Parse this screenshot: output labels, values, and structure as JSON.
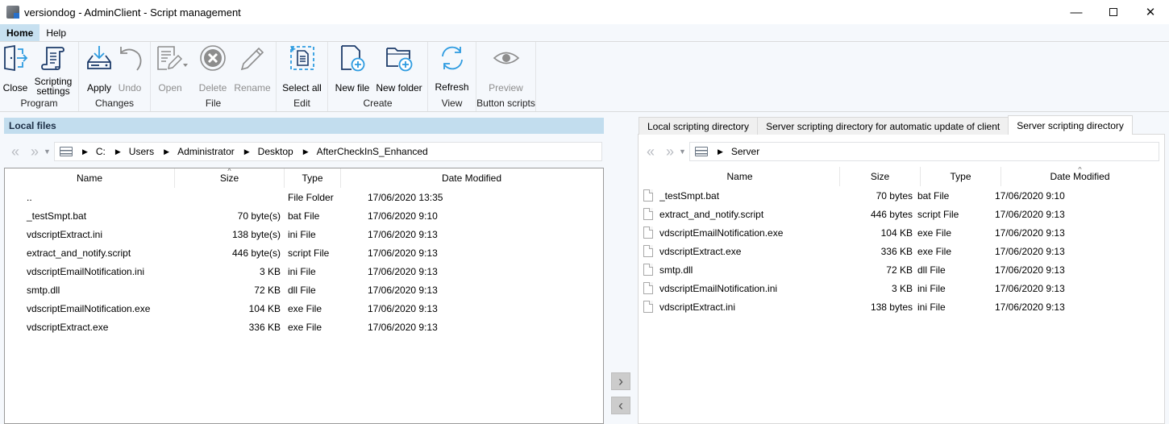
{
  "window": {
    "title": "versiondog - AdminClient - Script management",
    "controls": [
      "minimize",
      "maximize",
      "close"
    ]
  },
  "menu": {
    "tabs": [
      {
        "label": "Home",
        "active": true
      },
      {
        "label": "Help",
        "active": false
      }
    ]
  },
  "ribbon": {
    "groups": [
      {
        "label": "Program",
        "buttons": [
          {
            "label": "Close",
            "icon": "exit-door-icon",
            "enabled": true
          },
          {
            "label": "Scripting settings",
            "icon": "scroll-icon",
            "enabled": true
          }
        ]
      },
      {
        "label": "Changes",
        "buttons": [
          {
            "label": "Apply",
            "icon": "download-drive-icon",
            "enabled": true
          },
          {
            "label": "Undo",
            "icon": "undo-icon",
            "enabled": false
          }
        ]
      },
      {
        "label": "File",
        "buttons": [
          {
            "label": "Open",
            "icon": "open-document-icon",
            "enabled": false
          },
          {
            "label": "Delete",
            "icon": "delete-icon",
            "enabled": false
          },
          {
            "label": "Rename",
            "icon": "pencil-icon",
            "enabled": false
          }
        ]
      },
      {
        "label": "Edit",
        "buttons": [
          {
            "label": "Select all",
            "icon": "select-all-icon",
            "enabled": true
          }
        ]
      },
      {
        "label": "Create",
        "buttons": [
          {
            "label": "New file",
            "icon": "new-file-icon",
            "enabled": true
          },
          {
            "label": "New folder",
            "icon": "new-folder-icon",
            "enabled": true
          }
        ]
      },
      {
        "label": "View",
        "buttons": [
          {
            "label": "Refresh",
            "icon": "refresh-icon",
            "enabled": true
          }
        ]
      },
      {
        "label": "Button scripts",
        "buttons": [
          {
            "label": "Preview",
            "icon": "eye-icon",
            "enabled": false
          }
        ]
      }
    ]
  },
  "local": {
    "header": "Local files",
    "breadcrumb": [
      "C:",
      "Users",
      "Administrator",
      "Desktop",
      "AfterCheckInS_Enhanced"
    ],
    "columns": [
      "Name",
      "Size",
      "Type",
      "Date Modified"
    ],
    "sorted_column": "Size",
    "rows": [
      {
        "name": "..",
        "size": "",
        "type": "File Folder",
        "date": "17/06/2020 13:35"
      },
      {
        "name": "_testSmpt.bat",
        "size": "70 byte(s)",
        "type": "bat File",
        "date": "17/06/2020 9:10"
      },
      {
        "name": "vdscriptExtract.ini",
        "size": "138 byte(s)",
        "type": "ini File",
        "date": "17/06/2020 9:13"
      },
      {
        "name": "extract_and_notify.script",
        "size": "446 byte(s)",
        "type": "script File",
        "date": "17/06/2020 9:13"
      },
      {
        "name": "vdscriptEmailNotification.ini",
        "size": "3 KB",
        "type": "ini File",
        "date": "17/06/2020 9:13"
      },
      {
        "name": "smtp.dll",
        "size": "72 KB",
        "type": "dll File",
        "date": "17/06/2020 9:13"
      },
      {
        "name": "vdscriptEmailNotification.exe",
        "size": "104 KB",
        "type": "exe File",
        "date": "17/06/2020 9:13"
      },
      {
        "name": "vdscriptExtract.exe",
        "size": "336 KB",
        "type": "exe File",
        "date": "17/06/2020 9:13"
      }
    ]
  },
  "transfer": {
    "to_right": "›",
    "to_left": "‹"
  },
  "remote": {
    "tabs": [
      {
        "label": "Local scripting directory",
        "active": false
      },
      {
        "label": "Server scripting directory for automatic update of client",
        "active": false
      },
      {
        "label": "Server scripting directory",
        "active": true
      }
    ],
    "breadcrumb": [
      "Server"
    ],
    "columns": [
      "Name",
      "Size",
      "Type",
      "Date Modified"
    ],
    "sorted_column": "Date Modified",
    "rows": [
      {
        "name": "_testSmpt.bat",
        "size": "70 bytes",
        "type": "bat File",
        "date": "17/06/2020 9:10"
      },
      {
        "name": "extract_and_notify.script",
        "size": "446 bytes",
        "type": "script File",
        "date": "17/06/2020 9:13"
      },
      {
        "name": "vdscriptEmailNotification.exe",
        "size": "104 KB",
        "type": "exe File",
        "date": "17/06/2020 9:13"
      },
      {
        "name": "vdscriptExtract.exe",
        "size": "336 KB",
        "type": "exe File",
        "date": "17/06/2020 9:13"
      },
      {
        "name": "smtp.dll",
        "size": "72 KB",
        "type": "dll File",
        "date": "17/06/2020 9:13"
      },
      {
        "name": "vdscriptEmailNotification.ini",
        "size": "3 KB",
        "type": "ini File",
        "date": "17/06/2020 9:13"
      },
      {
        "name": "vdscriptExtract.ini",
        "size": "138 bytes",
        "type": "ini File",
        "date": "17/06/2020 9:13"
      }
    ]
  }
}
